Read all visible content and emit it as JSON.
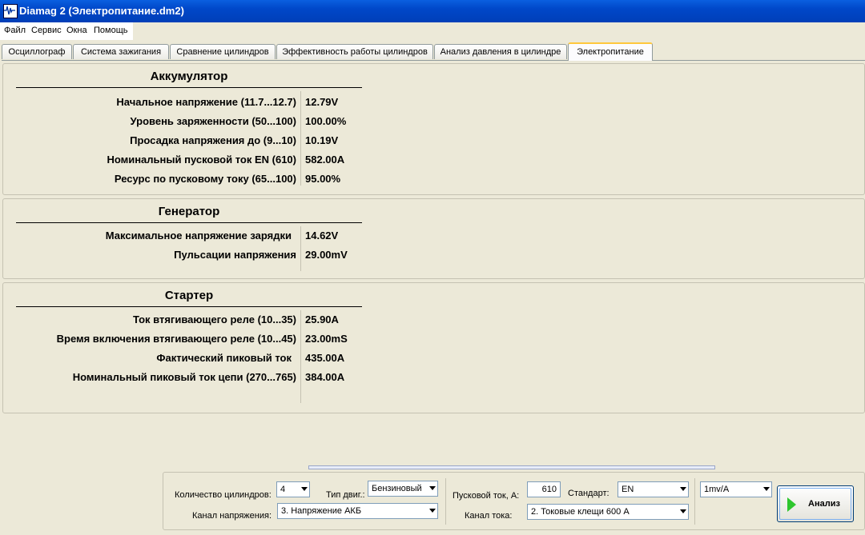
{
  "window": {
    "title": "Diamag 2 (Электропитание.dm2)"
  },
  "menu": [
    "Файл",
    "Сервис",
    "Окна",
    "Помощь"
  ],
  "tabs": [
    "Осциллограф",
    "Система зажигания",
    "Сравнение цилиндров",
    "Эффективность работы цилиндров",
    "Анализ давления в цилиндре",
    "Электропитание"
  ],
  "battery": {
    "heading": "Аккумулятор",
    "rows": [
      {
        "label": "Начальное напряжение (11.7...12.7)",
        "value": "12.79V"
      },
      {
        "label": "Уровень заряженности (50...100)",
        "value": "100.00%"
      },
      {
        "label": "Просадка напряжения до (9...10)",
        "value": "10.19V"
      },
      {
        "label": "Номинальный пусковой ток EN (610)",
        "value": "582.00A"
      },
      {
        "label": "Ресурс по пусковому току (65...100)",
        "value": "95.00%"
      }
    ]
  },
  "generator": {
    "heading": "Генератор",
    "rows": [
      {
        "label": "Максимальное напряжение зарядки",
        "value": "14.62V"
      },
      {
        "label": "Пульсации напряжения",
        "value": "29.00mV"
      }
    ]
  },
  "starter": {
    "heading": "Стартер",
    "rows": [
      {
        "label": "Ток втягивающего реле (10...35)",
        "value": "25.90A"
      },
      {
        "label": "Время включения втягивающего реле (10...45)",
        "value": "23.00mS"
      },
      {
        "label": "Фактический пиковый ток",
        "value": "435.00A"
      },
      {
        "label": "Номинальный пиковый ток цепи (270...765)",
        "value": "384.00A"
      }
    ]
  },
  "controls": {
    "cylinders_label": "Количество цилиндров:",
    "cylinders_value": "4",
    "engine_type_label": "Тип двиг.:",
    "engine_type_value": "Бензиновый",
    "voltage_channel_label": "Канал напряжения:",
    "voltage_channel_value": "3. Напряжение АКБ",
    "start_current_label": "Пусковой ток, А:",
    "start_current_value": "610",
    "standard_label": "Стандарт:",
    "standard_value": "EN",
    "current_channel_label": "Канал тока:",
    "current_channel_value": "2. Токовые клещи 600 А",
    "scale_value": "1mv/A",
    "analyze_label": "Анализ"
  }
}
